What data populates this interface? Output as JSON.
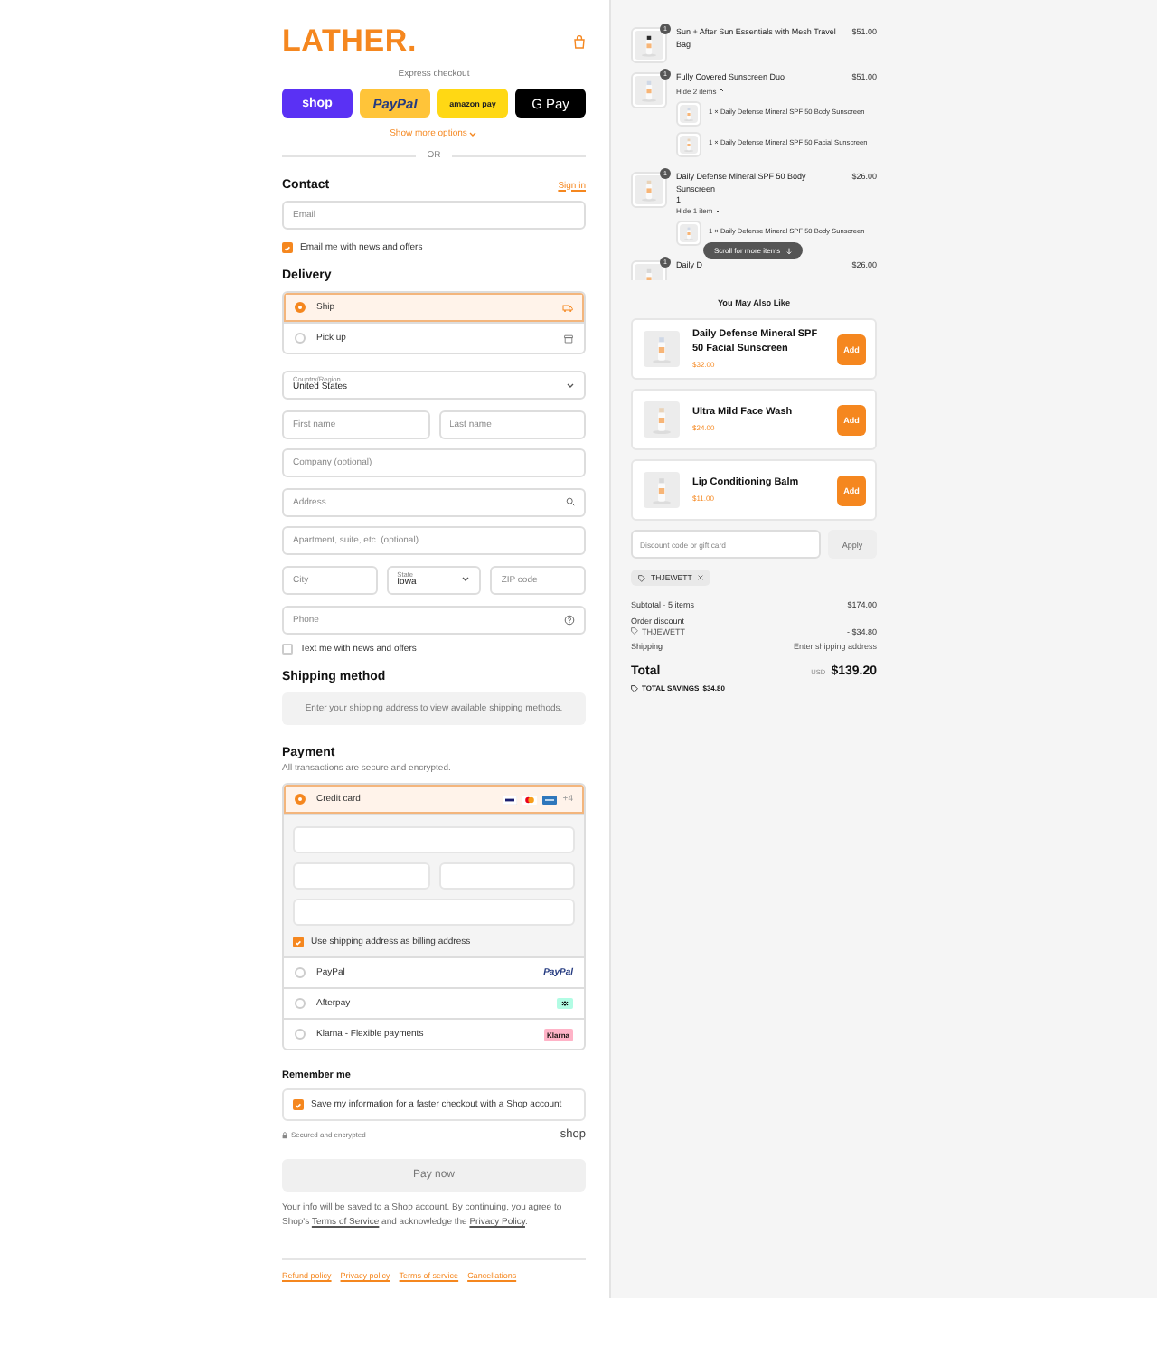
{
  "brand": {
    "logo": "LATHER."
  },
  "express": {
    "title": "Express checkout",
    "buttons": [
      {
        "kind": "shop",
        "label": "shop"
      },
      {
        "kind": "paypal",
        "label": "PayPal"
      },
      {
        "kind": "amazon",
        "label": "amazon pay"
      },
      {
        "kind": "gpay",
        "label": "G Pay"
      }
    ],
    "more": "Show more options",
    "or": "OR"
  },
  "contact": {
    "heading": "Contact",
    "sign_in": "Sign in",
    "email": {
      "placeholder": "Email"
    },
    "newsletter": {
      "label": "Email me with news and offers",
      "checked": true
    }
  },
  "delivery": {
    "heading": "Delivery",
    "options": [
      {
        "kind": "ship",
        "label": "Ship",
        "selected": true
      },
      {
        "kind": "pickup",
        "label": "Pick up",
        "selected": false
      }
    ],
    "rows": [
      [
        {
          "kind": "select",
          "label": "Country/Region",
          "value": "United States"
        }
      ],
      [
        {
          "kind": "text",
          "placeholder": "First name"
        },
        {
          "kind": "text",
          "placeholder": "Last name"
        }
      ],
      [
        {
          "kind": "text",
          "placeholder": "Company (optional)"
        }
      ],
      [
        {
          "kind": "search",
          "placeholder": "Address"
        }
      ],
      [
        {
          "kind": "text",
          "placeholder": "Apartment, suite, etc. (optional)"
        }
      ],
      [
        {
          "kind": "text",
          "placeholder": "City"
        },
        {
          "kind": "select",
          "label": "State",
          "value": "Iowa"
        },
        {
          "kind": "text",
          "placeholder": "ZIP code"
        }
      ],
      [
        {
          "kind": "help",
          "placeholder": "Phone"
        }
      ]
    ],
    "sms": {
      "label": "Text me with news and offers",
      "checked": false
    }
  },
  "shipping_method": {
    "heading": "Shipping method",
    "note": "Enter your shipping address to view available shipping methods."
  },
  "payment": {
    "heading": "Payment",
    "subtitle": "All transactions are secure and encrypted.",
    "methods": [
      {
        "kind": "card",
        "label": "Credit card",
        "selected": true,
        "more": "+4"
      },
      {
        "kind": "paypal",
        "label": "PayPal",
        "selected": false,
        "logo": "PayPal"
      },
      {
        "kind": "afterpay",
        "label": "Afterpay",
        "selected": false
      },
      {
        "kind": "klarna",
        "label": "Klarna - Flexible payments",
        "selected": false,
        "logo": "Klarna"
      }
    ],
    "billing": {
      "label": "Use shipping address as billing address",
      "checked": true
    }
  },
  "remember": {
    "heading": "Remember me",
    "save": {
      "label": "Save my information for a faster checkout with a Shop account",
      "checked": true
    },
    "secure": "Secured and encrypted",
    "shop": "shop"
  },
  "pay": {
    "label": "Pay now",
    "disabled": true
  },
  "legal": {
    "before": "Your info will be saved to a Shop account. By continuing, you agree to Shop's",
    "terms": "Terms of Service",
    "middle": "and acknowledge the",
    "privacy": "Privacy Policy",
    "after": "."
  },
  "footer_links": [
    "Refund policy",
    "Privacy policy",
    "Terms of service",
    "Cancellations"
  ],
  "cart": {
    "items": [
      {
        "name": "Sun + After Sun Essentials with Mesh Travel Bag",
        "price": "$51.00",
        "qty": "1"
      },
      {
        "name": "Fully Covered Sunscreen Duo",
        "price": "$51.00",
        "qty": "1",
        "toggle": "Hide 2 items",
        "children": [
          {
            "name": "1 × Daily Defense Mineral SPF 50 Body Sunscreen"
          },
          {
            "name": "1 × Daily Defense Mineral SPF 50 Facial Sunscreen"
          }
        ]
      },
      {
        "name": "Daily Defense Mineral SPF 50 Body Sunscreen",
        "price": "$26.00",
        "qty": "1",
        "note": "1",
        "toggle": "Hide 1 item",
        "children": [
          {
            "name": "1 × Daily Defense Mineral SPF 50 Body Sunscreen"
          }
        ]
      },
      {
        "name": "Daily D",
        "price": "$26.00",
        "qty": "1"
      }
    ],
    "scroll_hint": "Scroll for more items"
  },
  "upsell": {
    "heading": "You May Also Like",
    "items": [
      {
        "name": "Daily Defense Mineral SPF 50 Facial Sunscreen",
        "price": "$32.00",
        "button": "Add"
      },
      {
        "name": "Ultra Mild Face Wash",
        "price": "$24.00",
        "button": "Add"
      },
      {
        "name": "Lip Conditioning Balm",
        "price": "$11.00",
        "button": "Add"
      }
    ]
  },
  "discount": {
    "placeholder": "Discount code or gift card",
    "button": "Apply",
    "code": "THJEWETT"
  },
  "summary": {
    "subtotal_label": "Subtotal · 5 items",
    "subtotal": "$174.00",
    "discount_label": "Order discount",
    "discount_code": "THJEWETT",
    "discount_amount": "- $34.80",
    "shipping_label": "Shipping",
    "shipping_value": "Enter shipping address",
    "total_label": "Total",
    "currency": "USD",
    "total": "$139.20",
    "savings_label": "TOTAL SAVINGS",
    "savings": "$34.80"
  }
}
